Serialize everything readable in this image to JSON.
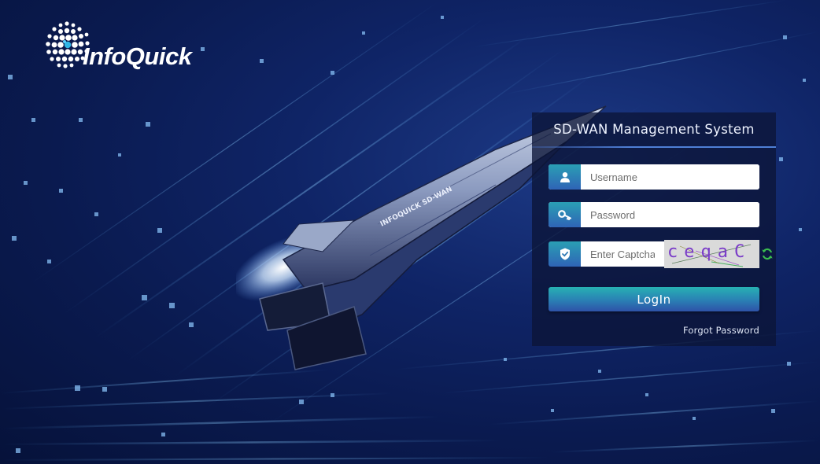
{
  "brand": {
    "name": "InfoQuick"
  },
  "illustration": {
    "rocket_label": "INFOQUICK SD-WAN"
  },
  "login": {
    "title": "SD-WAN Management System",
    "username_placeholder": "Username",
    "password_placeholder": "Password",
    "captcha_placeholder": "Enter Captcha",
    "captcha_text": "ceqaC",
    "login_label": "LogIn",
    "forgot_label": "Forgot Password"
  },
  "icons": {
    "username": "user-icon",
    "password": "key-icon",
    "captcha": "shield-check-icon",
    "refresh": "refresh-icon"
  },
  "colors": {
    "accent_teal": "#27b1b3",
    "accent_blue": "#2e52a8",
    "refresh_green": "#3bbd4f"
  }
}
